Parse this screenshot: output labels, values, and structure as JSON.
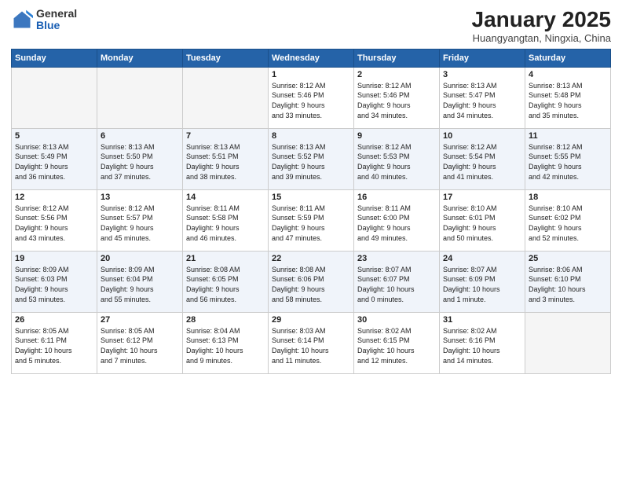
{
  "header": {
    "logo_general": "General",
    "logo_blue": "Blue",
    "month_year": "January 2025",
    "location": "Huangyangtan, Ningxia, China"
  },
  "days_of_week": [
    "Sunday",
    "Monday",
    "Tuesday",
    "Wednesday",
    "Thursday",
    "Friday",
    "Saturday"
  ],
  "weeks": [
    {
      "shaded": false,
      "days": [
        {
          "num": "",
          "info": ""
        },
        {
          "num": "",
          "info": ""
        },
        {
          "num": "",
          "info": ""
        },
        {
          "num": "1",
          "info": "Sunrise: 8:12 AM\nSunset: 5:46 PM\nDaylight: 9 hours\nand 33 minutes."
        },
        {
          "num": "2",
          "info": "Sunrise: 8:12 AM\nSunset: 5:46 PM\nDaylight: 9 hours\nand 34 minutes."
        },
        {
          "num": "3",
          "info": "Sunrise: 8:13 AM\nSunset: 5:47 PM\nDaylight: 9 hours\nand 34 minutes."
        },
        {
          "num": "4",
          "info": "Sunrise: 8:13 AM\nSunset: 5:48 PM\nDaylight: 9 hours\nand 35 minutes."
        }
      ]
    },
    {
      "shaded": true,
      "days": [
        {
          "num": "5",
          "info": "Sunrise: 8:13 AM\nSunset: 5:49 PM\nDaylight: 9 hours\nand 36 minutes."
        },
        {
          "num": "6",
          "info": "Sunrise: 8:13 AM\nSunset: 5:50 PM\nDaylight: 9 hours\nand 37 minutes."
        },
        {
          "num": "7",
          "info": "Sunrise: 8:13 AM\nSunset: 5:51 PM\nDaylight: 9 hours\nand 38 minutes."
        },
        {
          "num": "8",
          "info": "Sunrise: 8:13 AM\nSunset: 5:52 PM\nDaylight: 9 hours\nand 39 minutes."
        },
        {
          "num": "9",
          "info": "Sunrise: 8:12 AM\nSunset: 5:53 PM\nDaylight: 9 hours\nand 40 minutes."
        },
        {
          "num": "10",
          "info": "Sunrise: 8:12 AM\nSunset: 5:54 PM\nDaylight: 9 hours\nand 41 minutes."
        },
        {
          "num": "11",
          "info": "Sunrise: 8:12 AM\nSunset: 5:55 PM\nDaylight: 9 hours\nand 42 minutes."
        }
      ]
    },
    {
      "shaded": false,
      "days": [
        {
          "num": "12",
          "info": "Sunrise: 8:12 AM\nSunset: 5:56 PM\nDaylight: 9 hours\nand 43 minutes."
        },
        {
          "num": "13",
          "info": "Sunrise: 8:12 AM\nSunset: 5:57 PM\nDaylight: 9 hours\nand 45 minutes."
        },
        {
          "num": "14",
          "info": "Sunrise: 8:11 AM\nSunset: 5:58 PM\nDaylight: 9 hours\nand 46 minutes."
        },
        {
          "num": "15",
          "info": "Sunrise: 8:11 AM\nSunset: 5:59 PM\nDaylight: 9 hours\nand 47 minutes."
        },
        {
          "num": "16",
          "info": "Sunrise: 8:11 AM\nSunset: 6:00 PM\nDaylight: 9 hours\nand 49 minutes."
        },
        {
          "num": "17",
          "info": "Sunrise: 8:10 AM\nSunset: 6:01 PM\nDaylight: 9 hours\nand 50 minutes."
        },
        {
          "num": "18",
          "info": "Sunrise: 8:10 AM\nSunset: 6:02 PM\nDaylight: 9 hours\nand 52 minutes."
        }
      ]
    },
    {
      "shaded": true,
      "days": [
        {
          "num": "19",
          "info": "Sunrise: 8:09 AM\nSunset: 6:03 PM\nDaylight: 9 hours\nand 53 minutes."
        },
        {
          "num": "20",
          "info": "Sunrise: 8:09 AM\nSunset: 6:04 PM\nDaylight: 9 hours\nand 55 minutes."
        },
        {
          "num": "21",
          "info": "Sunrise: 8:08 AM\nSunset: 6:05 PM\nDaylight: 9 hours\nand 56 minutes."
        },
        {
          "num": "22",
          "info": "Sunrise: 8:08 AM\nSunset: 6:06 PM\nDaylight: 9 hours\nand 58 minutes."
        },
        {
          "num": "23",
          "info": "Sunrise: 8:07 AM\nSunset: 6:07 PM\nDaylight: 10 hours\nand 0 minutes."
        },
        {
          "num": "24",
          "info": "Sunrise: 8:07 AM\nSunset: 6:09 PM\nDaylight: 10 hours\nand 1 minute."
        },
        {
          "num": "25",
          "info": "Sunrise: 8:06 AM\nSunset: 6:10 PM\nDaylight: 10 hours\nand 3 minutes."
        }
      ]
    },
    {
      "shaded": false,
      "days": [
        {
          "num": "26",
          "info": "Sunrise: 8:05 AM\nSunset: 6:11 PM\nDaylight: 10 hours\nand 5 minutes."
        },
        {
          "num": "27",
          "info": "Sunrise: 8:05 AM\nSunset: 6:12 PM\nDaylight: 10 hours\nand 7 minutes."
        },
        {
          "num": "28",
          "info": "Sunrise: 8:04 AM\nSunset: 6:13 PM\nDaylight: 10 hours\nand 9 minutes."
        },
        {
          "num": "29",
          "info": "Sunrise: 8:03 AM\nSunset: 6:14 PM\nDaylight: 10 hours\nand 11 minutes."
        },
        {
          "num": "30",
          "info": "Sunrise: 8:02 AM\nSunset: 6:15 PM\nDaylight: 10 hours\nand 12 minutes."
        },
        {
          "num": "31",
          "info": "Sunrise: 8:02 AM\nSunset: 6:16 PM\nDaylight: 10 hours\nand 14 minutes."
        },
        {
          "num": "",
          "info": ""
        }
      ]
    }
  ]
}
